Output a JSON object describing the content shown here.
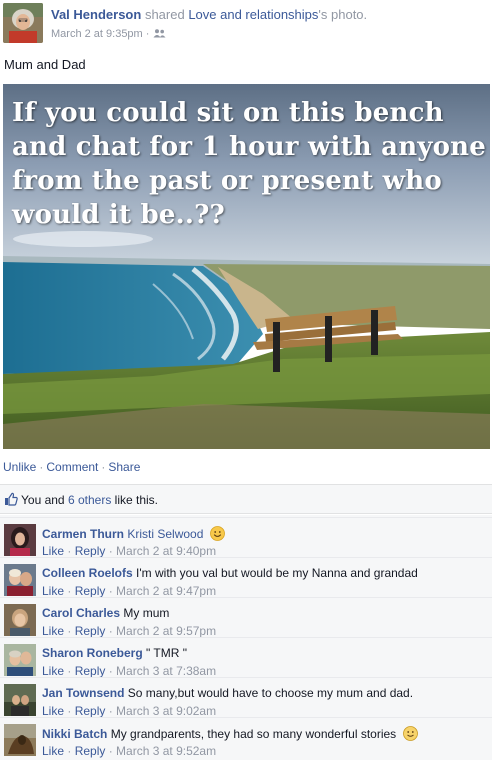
{
  "post": {
    "author": "Val Henderson",
    "shared_text": "shared",
    "shared_link": "Love and relationships",
    "shared_suffix": "'s photo.",
    "timestamp": "March 2 at 9:35pm",
    "audience_icon": "friends-icon",
    "caption": "Mum and Dad",
    "photo_text": "If you could sit on this bench and chat for 1 hour with anyone from the past or present who would it be..??"
  },
  "actions": {
    "unlike": "Unlike",
    "comment": "Comment",
    "share": "Share",
    "separator": "·"
  },
  "likes": {
    "prefix": "You and",
    "others_link": "6 others",
    "suffix": "like this."
  },
  "comments": [
    {
      "name": "Carmen Thurn",
      "text": "Kristi Selwood",
      "emoji": "smile-emoji",
      "like": "Like",
      "reply": "Reply",
      "time": "March 2 at 9:40pm"
    },
    {
      "name": "Colleen Roelofs",
      "text": "I'm with you val but would be my Nanna and grandad",
      "like": "Like",
      "reply": "Reply",
      "time": "March 2 at 9:47pm"
    },
    {
      "name": "Carol Charles",
      "text": "My mum",
      "like": "Like",
      "reply": "Reply",
      "time": "March 2 at 9:57pm"
    },
    {
      "name": "Sharon Roneberg",
      "text": "\" TMR \"",
      "like": "Like",
      "reply": "Reply",
      "time": "March 3 at 7:38am"
    },
    {
      "name": "Jan Townsend",
      "text": "So many,but would have to choose my mum and dad.",
      "like": "Like",
      "reply": "Reply",
      "time": "March 3 at 9:02am"
    },
    {
      "name": "Nikki Batch",
      "text": "My grandparents, they had so many wonderful stories",
      "emoji": "smile-emoji",
      "like": "Like",
      "reply": "Reply",
      "time": "March 3 at 9:52am"
    }
  ],
  "colors": {
    "link": "#3b5998",
    "meta": "#9197a3",
    "text": "#141823",
    "panel": "#f6f7f8"
  }
}
